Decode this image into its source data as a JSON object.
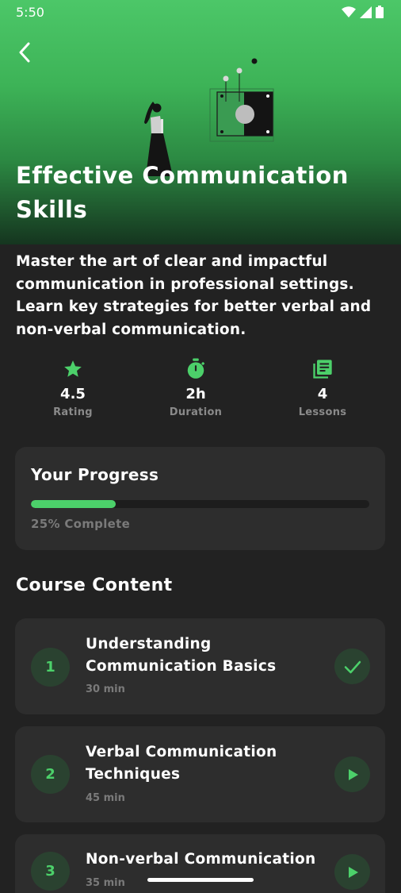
{
  "status_bar": {
    "time": "5:50"
  },
  "course": {
    "title": "Effective Communication Skills",
    "description": "Master the art of clear and impactful communication in professional settings. Learn key strategies for better verbal and non-verbal communication."
  },
  "stats": [
    {
      "icon": "star-icon",
      "value": "4.5",
      "label": "Rating"
    },
    {
      "icon": "stopwatch-icon",
      "value": "2h",
      "label": "Duration"
    },
    {
      "icon": "library-books-icon",
      "value": "4",
      "label": "Lessons"
    }
  ],
  "progress": {
    "title": "Your Progress",
    "fraction": 0.25,
    "label": "25% Complete"
  },
  "content": {
    "title": "Course Content",
    "lessons": [
      {
        "number": "1",
        "title": "Understanding Communication Basics",
        "duration": "30 min",
        "state": "completed",
        "action_icon": "check-icon"
      },
      {
        "number": "2",
        "title": "Verbal Communication Techniques",
        "duration": "45 min",
        "state": "available",
        "action_icon": "play-icon"
      },
      {
        "number": "3",
        "title": "Non-verbal Communication",
        "duration": "35 min",
        "state": "available",
        "action_icon": "play-icon"
      }
    ]
  },
  "colors": {
    "accent": "#4cd06a",
    "background": "#222222",
    "card": "#2d2d2d",
    "muted_text": "#7a7a7a"
  }
}
